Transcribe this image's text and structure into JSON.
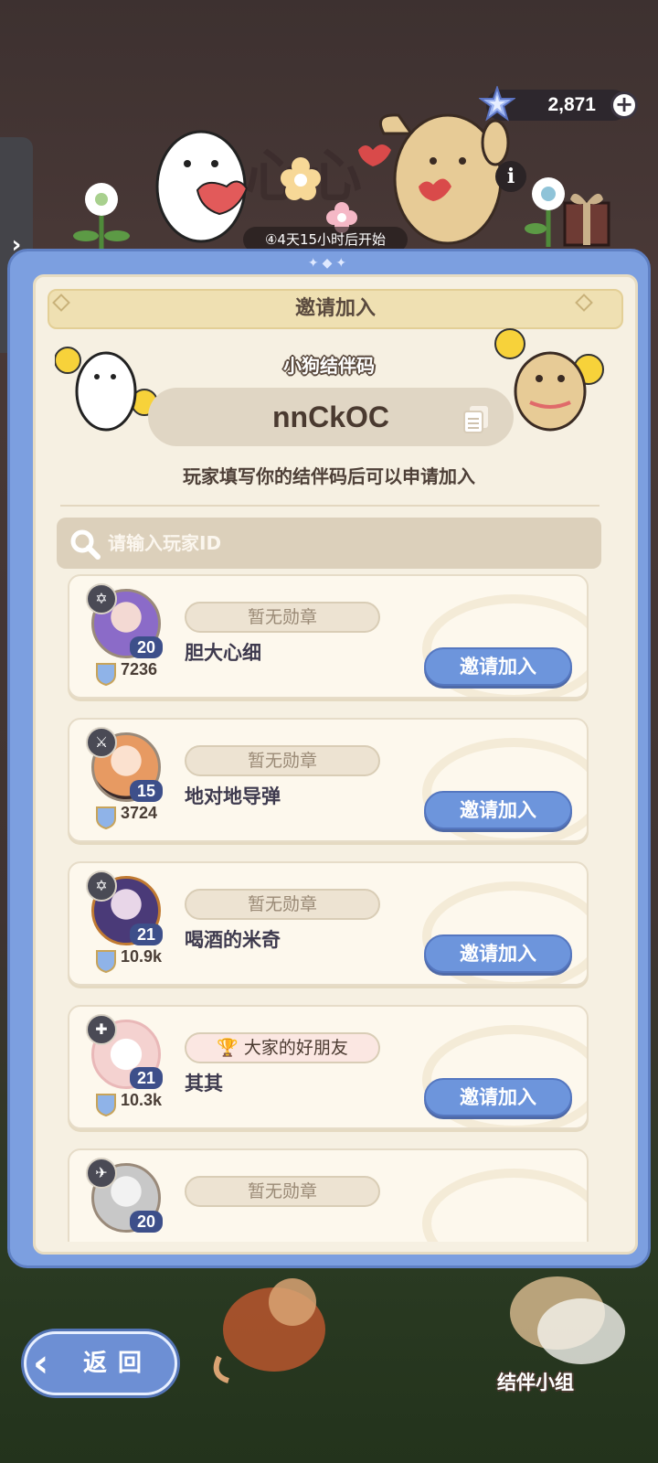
{
  "currency": {
    "value": "2,871",
    "add_label": "+"
  },
  "side_tab": {
    "arrow": "›"
  },
  "header": {
    "event_title": "心心",
    "timer": "④4天15小时后开始"
  },
  "panel": {
    "banner_title": "邀请加入",
    "code_label": "小狗结伴码",
    "code": "nnCkOC",
    "hint": "玩家填写你的结伴码后可以申请加入"
  },
  "search": {
    "placeholder": "请输入玩家ID"
  },
  "players": [
    {
      "name": "胆大心细",
      "level": "20",
      "power": "7236",
      "medal": "暂无勋章",
      "invite_label": "邀请加入",
      "class_icon": "compass-icon",
      "avatar_color": "#8b6bc8"
    },
    {
      "name": "地对地导弹",
      "level": "15",
      "power": "3724",
      "medal": "暂无勋章",
      "invite_label": "邀请加入",
      "class_icon": "sword-icon",
      "avatar_color": "#e79a62"
    },
    {
      "name": "喝酒的米奇",
      "level": "21",
      "power": "10.9k",
      "medal": "暂无勋章",
      "invite_label": "邀请加入",
      "class_icon": "compass-icon",
      "avatar_color": "#4a3a78"
    },
    {
      "name": "其其",
      "level": "21",
      "power": "10.3k",
      "medal": "大家的好朋友",
      "invite_label": "邀请加入",
      "class_icon": "cross-icon",
      "avatar_color": "#f4d2d0"
    },
    {
      "name": "",
      "level": "20",
      "power": "",
      "medal": "暂无勋章",
      "invite_label": "",
      "class_icon": "wing-icon",
      "avatar_color": "#c8c8c8"
    }
  ],
  "footer": {
    "back_label": "返回",
    "group_label": "结伴小组"
  }
}
